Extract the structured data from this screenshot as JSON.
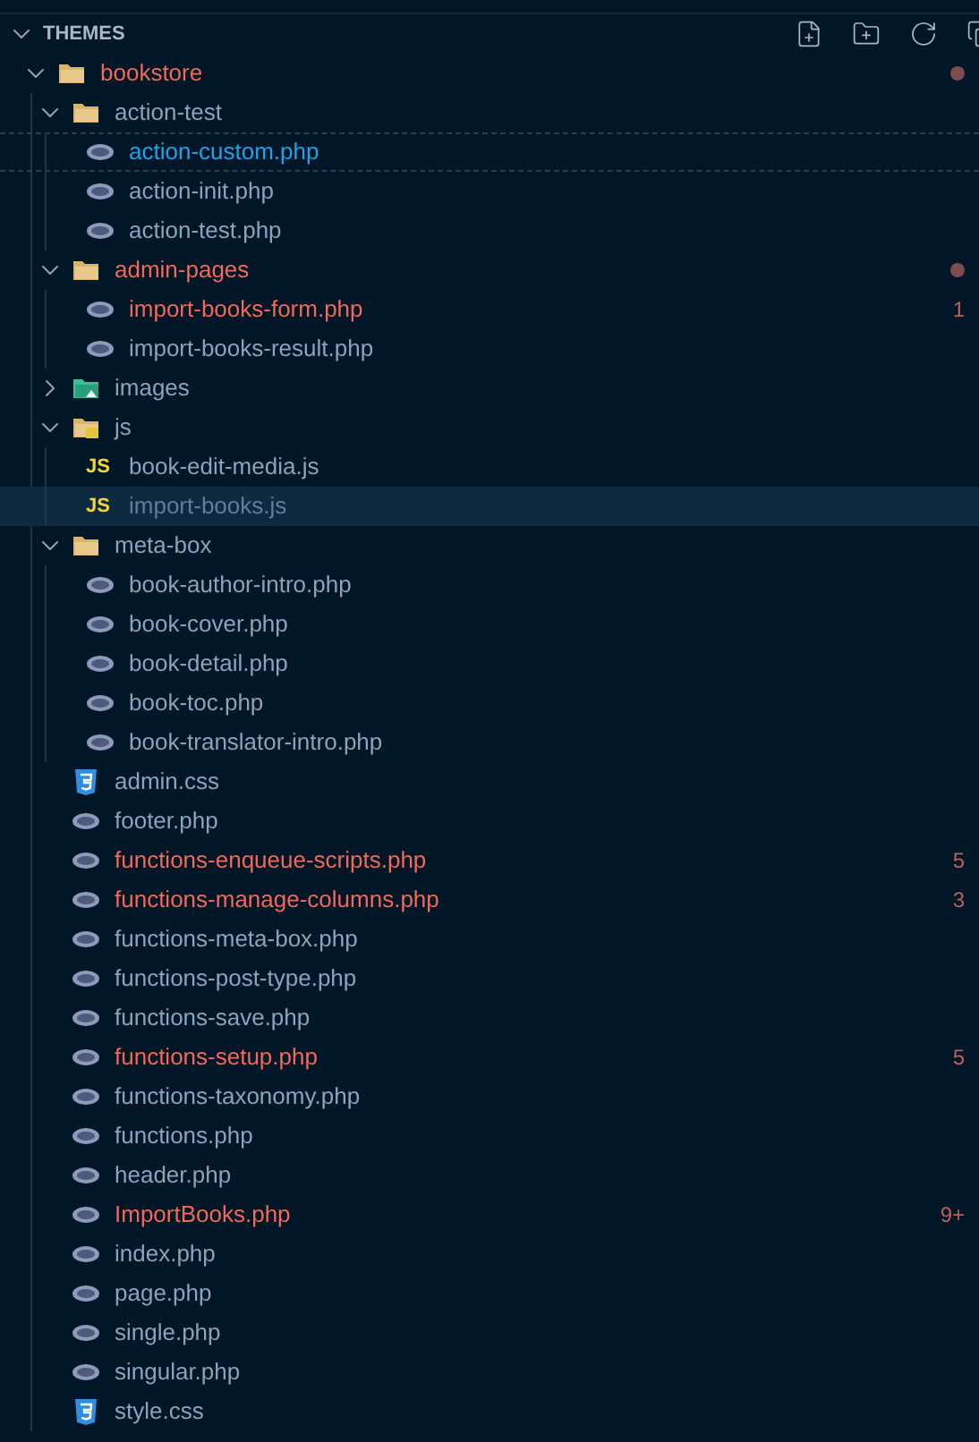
{
  "section": {
    "title": "THEMES",
    "expanded": true
  },
  "tree": [
    {
      "kind": "folder",
      "name": "bookstore",
      "expanded": true,
      "error": true,
      "dot": true,
      "children": [
        {
          "kind": "folder",
          "name": "action-test",
          "expanded": true,
          "error": false,
          "children": [
            {
              "kind": "php",
              "name": "action-custom.php",
              "focused": true
            },
            {
              "kind": "php",
              "name": "action-init.php",
              "error": false
            },
            {
              "kind": "php",
              "name": "action-test.php",
              "error": false
            }
          ]
        },
        {
          "kind": "folder",
          "name": "admin-pages",
          "expanded": true,
          "error": true,
          "dot": true,
          "children": [
            {
              "kind": "php",
              "name": "import-books-form.php",
              "error": true,
              "badge": "1"
            },
            {
              "kind": "php",
              "name": "import-books-result.php",
              "error": false
            }
          ]
        },
        {
          "kind": "images-folder",
          "name": "images",
          "expanded": false,
          "error": false
        },
        {
          "kind": "js-folder",
          "name": "js",
          "expanded": true,
          "error": false,
          "children": [
            {
              "kind": "js",
              "icon_text": "JS",
              "name": "book-edit-media.js",
              "error": false,
              "selected": false
            },
            {
              "kind": "js",
              "icon_text": "JS",
              "name": "import-books.js",
              "selected": true
            }
          ]
        },
        {
          "kind": "folder",
          "name": "meta-box",
          "expanded": true,
          "error": false,
          "children": [
            {
              "kind": "php",
              "name": "book-author-intro.php",
              "error": false
            },
            {
              "kind": "php",
              "name": "book-cover.php",
              "error": false
            },
            {
              "kind": "php",
              "name": "book-detail.php",
              "error": false
            },
            {
              "kind": "php",
              "name": "book-toc.php",
              "error": false
            },
            {
              "kind": "php",
              "name": "book-translator-intro.php",
              "error": false
            }
          ]
        },
        {
          "kind": "css",
          "name": "admin.css",
          "error": false
        },
        {
          "kind": "php",
          "name": "footer.php",
          "error": false
        },
        {
          "kind": "php",
          "name": "functions-enqueue-scripts.php",
          "error": true,
          "badge": "5"
        },
        {
          "kind": "php",
          "name": "functions-manage-columns.php",
          "error": true,
          "badge": "3"
        },
        {
          "kind": "php",
          "name": "functions-meta-box.php",
          "error": false
        },
        {
          "kind": "php",
          "name": "functions-post-type.php",
          "error": false
        },
        {
          "kind": "php",
          "name": "functions-save.php",
          "error": false
        },
        {
          "kind": "php",
          "name": "functions-setup.php",
          "error": true,
          "badge": "5"
        },
        {
          "kind": "php",
          "name": "functions-taxonomy.php",
          "error": false
        },
        {
          "kind": "php",
          "name": "functions.php",
          "error": false
        },
        {
          "kind": "php",
          "name": "header.php",
          "error": false
        },
        {
          "kind": "php",
          "name": "ImportBooks.php",
          "error": true,
          "badge": "9+"
        },
        {
          "kind": "php",
          "name": "index.php",
          "error": false
        },
        {
          "kind": "php",
          "name": "page.php",
          "error": false
        },
        {
          "kind": "php",
          "name": "single.php",
          "error": false
        },
        {
          "kind": "php",
          "name": "singular.php",
          "error": false
        },
        {
          "kind": "css",
          "name": "style.css",
          "error": false
        }
      ]
    }
  ]
}
